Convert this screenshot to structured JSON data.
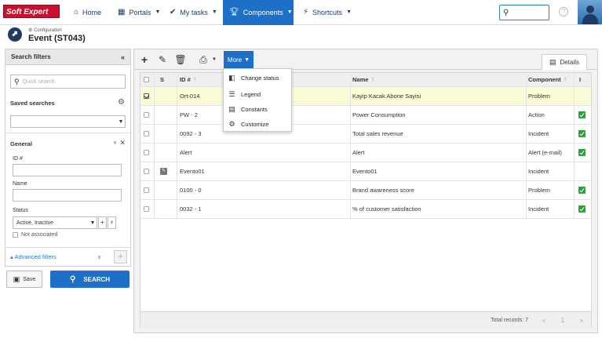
{
  "brand": {
    "logo_text": "Soft Expert",
    "accent": "#1e6fc7",
    "logo_color": "#c8102e"
  },
  "nav": {
    "items": [
      {
        "label": "Home",
        "icon": "home-icon"
      },
      {
        "label": "Portals",
        "icon": "portals-icon"
      },
      {
        "label": "My tasks",
        "icon": "tasks-icon"
      },
      {
        "label": "Components",
        "icon": "trophy-icon",
        "active": true
      },
      {
        "label": "Shortcuts",
        "icon": "bolt-icon"
      }
    ]
  },
  "header": {
    "breadcrumb": "Configuration",
    "title": "Event (ST043)"
  },
  "filters": {
    "title": "Search filters",
    "quick_search_placeholder": "Quick search",
    "saved_searches_label": "Saved searches",
    "general_label": "General",
    "id_label": "ID #",
    "name_label": "Name",
    "status_label": "Status",
    "status_value": "Active, Inactive",
    "not_associated_label": "Not associated",
    "advanced_label": "Advanced filters"
  },
  "buttons": {
    "save_label": "Save",
    "search_label": "SEARCH"
  },
  "toolbar": {
    "more_label": "More",
    "details_label": "Details"
  },
  "more_menu": {
    "items": [
      {
        "label": "Change status",
        "icon": "change-status-icon"
      },
      {
        "label": "Legend",
        "icon": "legend-icon"
      },
      {
        "label": "Constants",
        "icon": "constants-icon"
      },
      {
        "label": "Customize",
        "icon": "gear-icon"
      }
    ]
  },
  "table": {
    "columns": {
      "s": "S",
      "id": "ID #",
      "name": "Name",
      "component": "Component",
      "i": "I"
    },
    "rows": [
      {
        "id": "Ort-014",
        "name": "Kayip Kacak Abone Sayisi",
        "component": "Problem",
        "checked": true,
        "indicator": false,
        "edit": false
      },
      {
        "id": "PW - 2",
        "name": "Power Consumption",
        "component": "Action",
        "checked": false,
        "indicator": true,
        "edit": false
      },
      {
        "id": "0092 - 3",
        "name": "Total sales revenue",
        "component": "Incident",
        "checked": false,
        "indicator": true,
        "edit": false
      },
      {
        "id": "Alert",
        "name": "Alert",
        "component": "Alert (e-mail)",
        "checked": false,
        "indicator": true,
        "edit": false
      },
      {
        "id": "Evento01",
        "name": "Evento01",
        "component": "Incident",
        "checked": false,
        "indicator": false,
        "edit": true
      },
      {
        "id": "0100 - 0",
        "name": "Brand awareness score",
        "component": "Problem",
        "checked": false,
        "indicator": true,
        "edit": false
      },
      {
        "id": "0032 - 1",
        "name": "% of customer satisfaction",
        "component": "Incident",
        "checked": false,
        "indicator": true,
        "edit": false
      }
    ],
    "total_records": "Total records: 7",
    "page_number": "1"
  }
}
